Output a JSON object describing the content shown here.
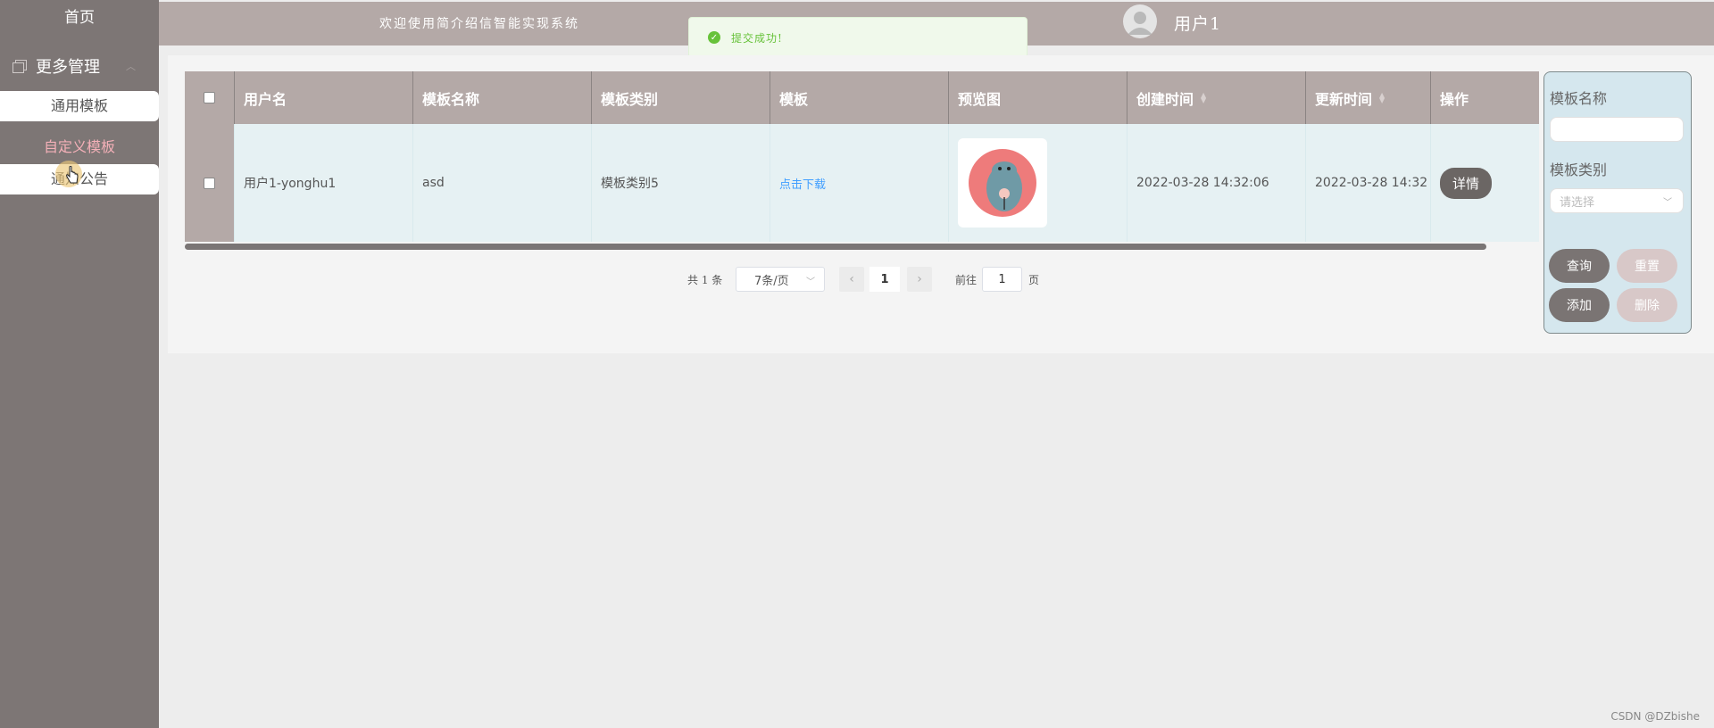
{
  "sidebar": {
    "home": "首页",
    "group": "更多管理",
    "items": [
      {
        "label": "通用模板"
      },
      {
        "label": "自定义模板"
      },
      {
        "label": "通知公告"
      }
    ]
  },
  "header": {
    "welcome": "欢迎使用简介绍信智能实现系统",
    "username": "用户1"
  },
  "toast": {
    "message": "提交成功!"
  },
  "table": {
    "columns": [
      "用户名",
      "模板名称",
      "模板类别",
      "模板",
      "预览图",
      "创建时间",
      "更新时间",
      "操作"
    ],
    "rows": [
      {
        "username": "用户1-yonghu1",
        "template_name": "asd",
        "template_category": "模板类别5",
        "template_link": "点击下载",
        "created": "2022-03-28 14:32:06",
        "updated": "2022-03-28 14:32",
        "action": "详情"
      }
    ]
  },
  "pagination": {
    "total": "共 1 条",
    "page_size": "7条/页",
    "prev": "‹",
    "current": "1",
    "next": "›",
    "goto": "前往",
    "goto_value": "1",
    "page_suffix": "页"
  },
  "search": {
    "name_label": "模板名称",
    "category_label": "模板类别",
    "category_placeholder": "请选择",
    "query": "查询",
    "reset": "重置",
    "add": "添加",
    "delete": "删除"
  },
  "watermark": "CSDN @DZbishe",
  "colors": {
    "sidebar": "#7d7675",
    "header": "#b4a9a7",
    "success": "#67c23a",
    "link": "#409eff",
    "active_menu": "#f4b0b8"
  }
}
